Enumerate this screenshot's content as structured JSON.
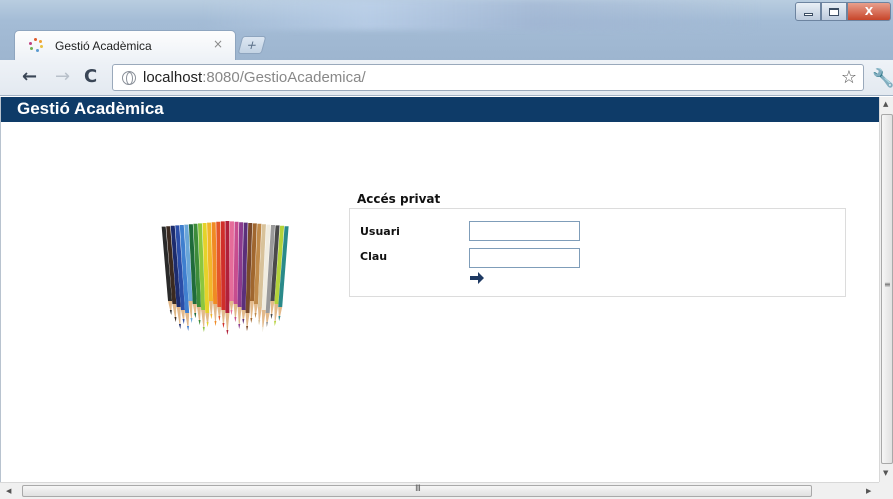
{
  "browser": {
    "tab_title": "Gestió Acadèmica",
    "tab_close": "×",
    "new_tab": "+",
    "url_host": "localhost",
    "url_rest": ":8080/GestioAcademica/",
    "back_icon": "←",
    "forward_icon": "→",
    "reload_icon": "C",
    "bookmark_icon": "☆",
    "wrench_icon": "🔧",
    "window_close": "X"
  },
  "app": {
    "title": "Gestió Acadèmica",
    "header_color": "#0e3b68"
  },
  "login": {
    "heading": "Accés privat",
    "user_label": "Usuari",
    "password_label": "Clau",
    "user_value": "",
    "password_value": "",
    "submit_icon": "arrow-right-icon"
  },
  "scrollbar": {
    "grip": "III"
  },
  "pencil_colors": [
    "#2a2a2a",
    "#3b2a20",
    "#1c2c6e",
    "#2b4ea8",
    "#3f7fcf",
    "#6aa6d8",
    "#1f6b3a",
    "#3d8c3a",
    "#8cc63e",
    "#e5d22a",
    "#f2b62a",
    "#f08a24",
    "#e3562a",
    "#d02f2a",
    "#b0203a",
    "#e56c9a",
    "#c74d8f",
    "#8a3b8f",
    "#5b2f7a",
    "#7a4a2a",
    "#a0662e",
    "#c08a4a",
    "#d8c29a",
    "#f0ece0",
    "#9a9a9a",
    "#4a4a4a",
    "#b3d23a",
    "#2a8a8a"
  ]
}
